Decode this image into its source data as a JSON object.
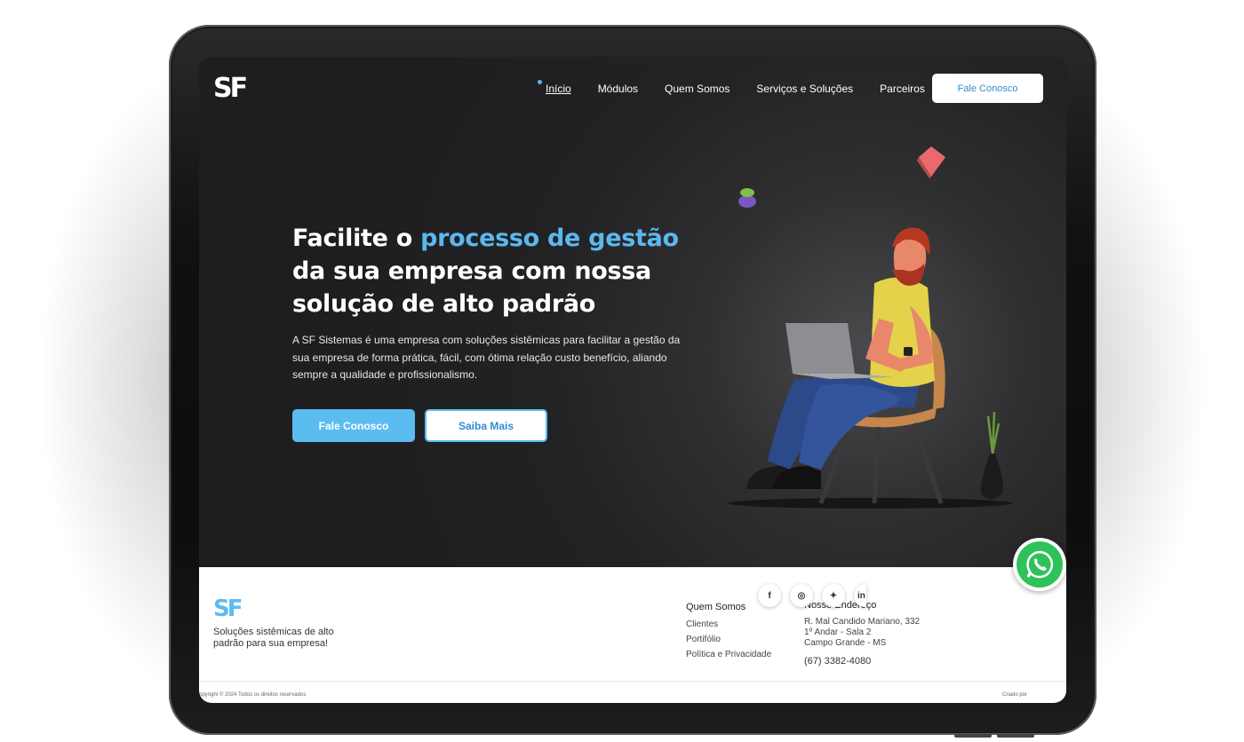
{
  "brand": {
    "logo_text": "SF",
    "accent_color": "#5bbcf0"
  },
  "nav": {
    "items": [
      {
        "label": "Início",
        "active": true
      },
      {
        "label": "Módulos"
      },
      {
        "label": "Quem Somos"
      },
      {
        "label": "Serviços e Soluções"
      },
      {
        "label": "Parceiros"
      }
    ],
    "cta_label": "Fale Conosco"
  },
  "hero": {
    "headline_pre": "Facilite o ",
    "headline_highlight": "processo de gestão",
    "headline_post": " da sua empresa com nossa solução de alto padrão",
    "description": "A SF Sistemas é uma empresa com soluções sistêmicas para facilitar a gestão da sua empresa de forma prática, fácil, com ótima relação custo benefício, aliando sempre a qualidade e profissionalismo.",
    "primary_button": "Fale Conosco",
    "secondary_button": "Saiba Mais"
  },
  "footer": {
    "logo_text": "SF",
    "tagline": "Soluções sistêmicas de alto padrão para sua empresa!",
    "links_col": {
      "heading": "Quem Somos",
      "items": [
        "Clientes",
        "Portifólio",
        "Política e Privacidade"
      ]
    },
    "address_col": {
      "heading": "Nosso Endereço",
      "line1": "R. Mal Candido Mariano, 332",
      "line2": "1º Andar - Sala 2",
      "line3": "Campo Grande - MS",
      "phone": "(67) 3382-4080"
    },
    "social": [
      {
        "icon": "facebook-icon",
        "glyph": "f"
      },
      {
        "icon": "instagram-icon",
        "glyph": "◎"
      },
      {
        "icon": "twitter-icon",
        "glyph": "✦"
      },
      {
        "icon": "linkedin-icon",
        "glyph": "in"
      }
    ],
    "copyright": "opyright © 2024 Todos os direitos reservados",
    "credit": "Criado por"
  },
  "whatsapp": {
    "icon": "whatsapp-icon"
  }
}
